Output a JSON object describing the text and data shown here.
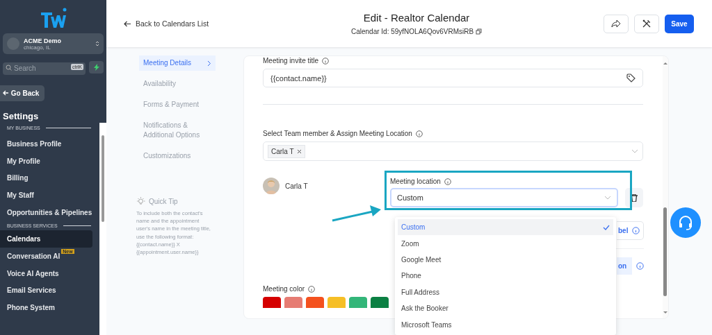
{
  "sidebar": {
    "account": {
      "name": "ACME Demo",
      "location": "chicago, IL"
    },
    "search": {
      "placeholder": "Search",
      "shortcut": "ctrlK"
    },
    "go_back": "Go Back",
    "title": "Settings",
    "items": [
      {
        "kind": "section",
        "label": "MY BUSINESS"
      },
      {
        "kind": "item",
        "label": "Business Profile",
        "selected": false
      },
      {
        "kind": "item",
        "label": "My Profile",
        "selected": false
      },
      {
        "kind": "item",
        "label": "Billing",
        "selected": false
      },
      {
        "kind": "item",
        "label": "My Staff",
        "selected": false
      },
      {
        "kind": "item",
        "label": "Opportunities & Pipelines",
        "selected": false
      },
      {
        "kind": "section",
        "label": "BUSINESS SERVICES"
      },
      {
        "kind": "item",
        "label": "Calendars",
        "selected": true
      },
      {
        "kind": "item",
        "label": "Conversation AI",
        "selected": false,
        "badge": "New"
      },
      {
        "kind": "item",
        "label": "Voice AI Agents",
        "selected": false
      },
      {
        "kind": "item",
        "label": "Email Services",
        "selected": false
      },
      {
        "kind": "item",
        "label": "Phone System",
        "selected": false
      }
    ]
  },
  "header": {
    "back": "Back to Calendars List",
    "title": "Edit - Realtor Calendar",
    "calendar_id": "Calendar Id: 59yfNOLA6Qov6VRMsiRB",
    "save": "Save"
  },
  "nav": [
    {
      "label": "Meeting Details",
      "selected": true
    },
    {
      "label": "Availability",
      "selected": false
    },
    {
      "label": "Forms & Payment",
      "selected": false
    },
    {
      "label": "Notifications & Additional Options",
      "selected": false
    },
    {
      "label": "Customizations",
      "selected": false
    }
  ],
  "quick_tip": {
    "title": "Quick Tip",
    "text": "To include both the contact's name and the appointment user's name in the meeting title, use the following format: {{contact.name}} X {{appointment.user.name}}"
  },
  "form": {
    "invite_title": {
      "label": "Meeting invite title",
      "value": "{{contact.name}}"
    },
    "team": {
      "label": "Select Team member & Assign Meeting Location",
      "tags": [
        "Carla T"
      ]
    },
    "member": {
      "name": "Carla T"
    },
    "location": {
      "label": "Meeting location",
      "value": "Custom",
      "options": [
        {
          "label": "Custom",
          "selected": true
        },
        {
          "label": "Zoom",
          "selected": false
        },
        {
          "label": "Google Meet",
          "selected": false
        },
        {
          "label": "Phone",
          "selected": false
        },
        {
          "label": "Full Address",
          "selected": false
        },
        {
          "label": "Ask the Booker",
          "selected": false
        },
        {
          "label": "Microsoft Teams",
          "selected": false
        }
      ]
    },
    "partial_buttons": [
      "bel",
      "on"
    ],
    "color": {
      "label": "Meeting color",
      "swatches": [
        {
          "color": "#d50000"
        },
        {
          "color": "#e67c73"
        },
        {
          "color": "#f4511e"
        },
        {
          "color": "#f6bf26"
        },
        {
          "color": "#33b679"
        },
        {
          "color": "#0b8043"
        }
      ]
    }
  }
}
